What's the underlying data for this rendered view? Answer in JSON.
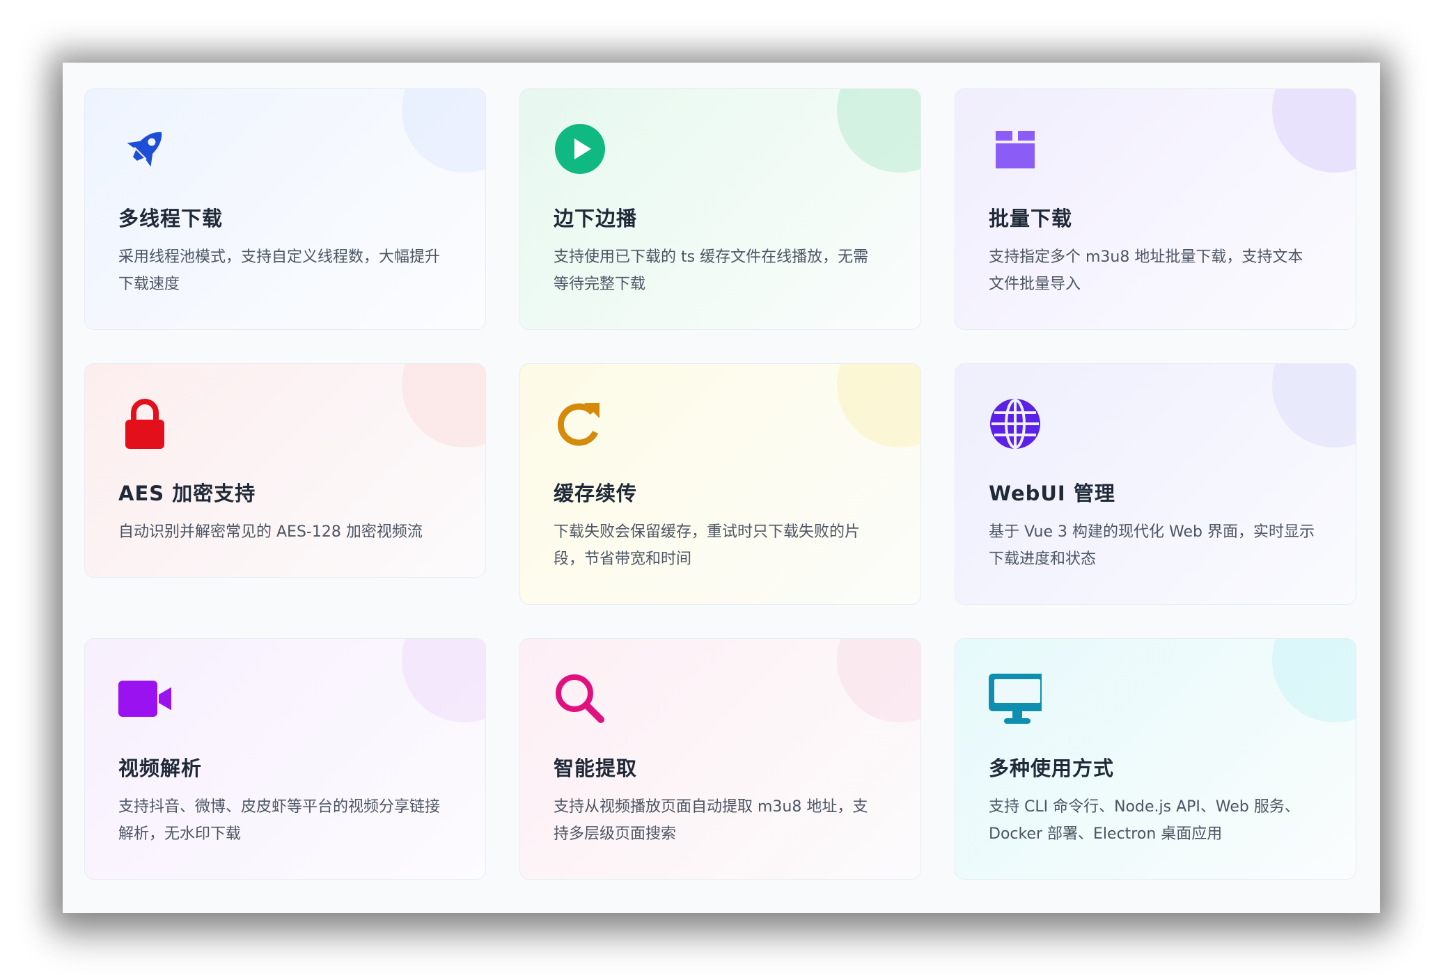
{
  "cards": [
    {
      "title": "多线程下载",
      "desc": "采用线程池模式，支持自定义线程数，大幅提升下载速度",
      "icon": "rocket-icon",
      "color": "#1d4ed8"
    },
    {
      "title": "边下边播",
      "desc": "支持使用已下载的 ts 缓存文件在线播放，无需等待完整下载",
      "icon": "play-circle-icon",
      "color": "#10b981"
    },
    {
      "title": "批量下载",
      "desc": "支持指定多个 m3u8 地址批量下载，支持文本文件批量导入",
      "icon": "box-icon",
      "color": "#8b5cf6"
    },
    {
      "title": "AES 加密支持",
      "desc": "自动识别并解密常见的 AES-128 加密视频流",
      "icon": "lock-icon",
      "color": "#e3101b"
    },
    {
      "title": "缓存续传",
      "desc": "下载失败会保留缓存，重试时只下载失败的片段，节省带宽和时间",
      "icon": "redo-icon",
      "color": "#d68a0c"
    },
    {
      "title": "WebUI 管理",
      "desc": "基于 Vue 3 构建的现代化 Web 界面，实时显示下载进度和状态",
      "icon": "globe-icon",
      "color": "#5b21e6"
    },
    {
      "title": "视频解析",
      "desc": "支持抖音、微博、皮皮虾等平台的视频分享链接解析，无水印下载",
      "icon": "video-camera-icon",
      "color": "#9b12f0"
    },
    {
      "title": "智能提取",
      "desc": "支持从视频播放页面自动提取 m3u8 地址，支持多层级页面搜索",
      "icon": "search-icon",
      "color": "#e0117e"
    },
    {
      "title": "多种使用方式",
      "desc": "支持 CLI 命令行、Node.js API、Web 服务、Docker 部署、Electron 桌面应用",
      "icon": "monitor-icon",
      "color": "#0e8fb0"
    }
  ]
}
